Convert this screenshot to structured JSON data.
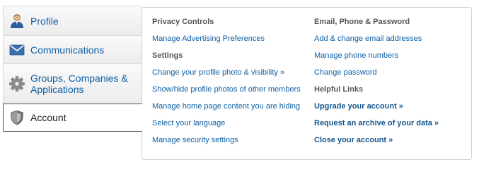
{
  "sidebar": {
    "items": [
      {
        "label": "Profile",
        "icon": "person-icon"
      },
      {
        "label": "Communications",
        "icon": "envelope-icon"
      },
      {
        "label": "Groups, Companies & Applications",
        "icon": "gear-icon"
      },
      {
        "label": "Account",
        "icon": "shield-icon"
      }
    ]
  },
  "panel": {
    "left": {
      "privacy_header": "Privacy Controls",
      "manage_ads": "Manage Advertising Preferences",
      "settings_header": "Settings",
      "profile_photo": "Change your profile photo & visibility »",
      "show_hide_photos": "Show/hide profile photos of other members",
      "home_content": "Manage home page content you are hiding",
      "language": "Select your language",
      "security": "Manage security settings"
    },
    "right": {
      "email_header": "Email, Phone & Password",
      "add_email": "Add & change email addresses",
      "phone": "Manage phone numbers",
      "password": "Change password",
      "helpful_header": "Helpful Links",
      "upgrade": "Upgrade your account »",
      "archive": "Request an archive of your data »",
      "close": "Close your account »"
    }
  },
  "colors": {
    "link": "#0e5fa6",
    "header": "#555555",
    "border": "#d4d4d4"
  }
}
